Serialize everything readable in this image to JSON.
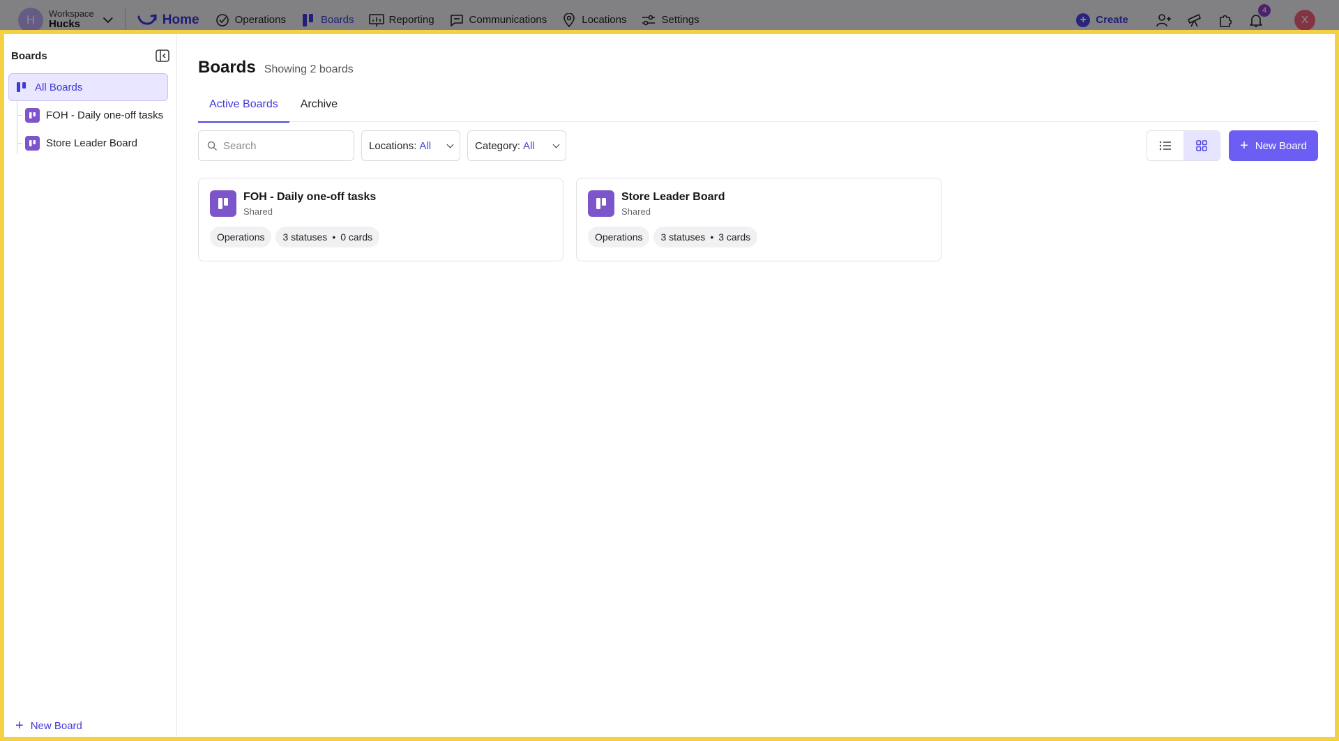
{
  "topnav": {
    "workspace_initial": "H",
    "workspace_label": "Workspace",
    "workspace_name": "Hucks",
    "home_label": "Home",
    "items": [
      {
        "label": "Operations",
        "icon": "check-circle-icon"
      },
      {
        "label": "Boards",
        "icon": "boards-icon"
      },
      {
        "label": "Reporting",
        "icon": "chart-board-icon"
      },
      {
        "label": "Communications",
        "icon": "chat-icon"
      },
      {
        "label": "Locations",
        "icon": "map-pin-icon"
      },
      {
        "label": "Settings",
        "icon": "sliders-icon"
      }
    ],
    "active_item": "Boards",
    "create_label": "Create",
    "notification_count": "4",
    "user_initial": "X"
  },
  "sidebar": {
    "title": "Boards",
    "all_boards_label": "All Boards",
    "items": [
      {
        "label": "FOH - Daily one-off tasks"
      },
      {
        "label": "Store Leader Board"
      }
    ],
    "new_board_label": "New Board"
  },
  "main": {
    "title": "Boards",
    "subtitle": "Showing 2 boards",
    "tabs": [
      {
        "label": "Active Boards",
        "active": true
      },
      {
        "label": "Archive",
        "active": false
      }
    ],
    "search_placeholder": "Search",
    "filters": [
      {
        "label": "Locations:",
        "value": "All"
      },
      {
        "label": "Category:",
        "value": "All"
      }
    ],
    "view_mode": "grid",
    "new_board_label": "New Board",
    "cards": [
      {
        "name": "FOH - Daily one-off tasks",
        "visibility": "Shared",
        "category": "Operations",
        "statuses": "3 statuses",
        "cards": "0 cards"
      },
      {
        "name": "Store Leader Board",
        "visibility": "Shared",
        "category": "Operations",
        "statuses": "3 statuses",
        "cards": "3 cards"
      }
    ]
  },
  "colors": {
    "accent": "#4b44e0",
    "board_icon": "#7b55c9",
    "highlight_frame": "#f6d043",
    "primary_button": "#6c5ef2"
  }
}
